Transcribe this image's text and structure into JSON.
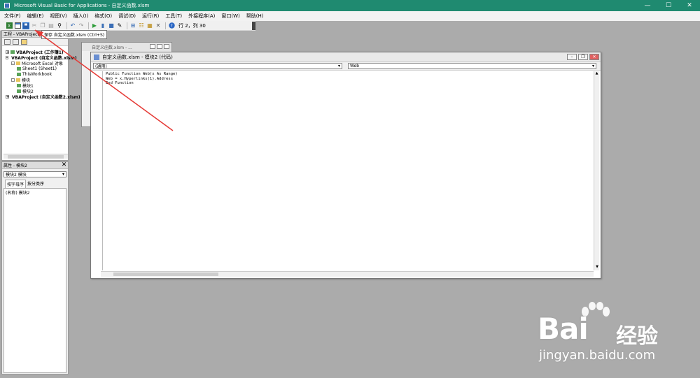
{
  "window": {
    "title": "Microsoft Visual Basic for Applications - 自定义函数.xlsm",
    "minimize": "—",
    "maximize": "☐",
    "close": "✕"
  },
  "menu": [
    "文件(F)",
    "编辑(E)",
    "视图(V)",
    "插入(I)",
    "格式(O)",
    "调试(D)",
    "运行(R)",
    "工具(T)",
    "外接程序(A)",
    "窗口(W)",
    "帮助(H)"
  ],
  "toolbar": {
    "position_text": "行 2，列 30"
  },
  "tooltip": "保存 自定义函数.xlsm (Ctrl+S)",
  "project_panel": {
    "title": "工程 - VBAProject",
    "tree": [
      {
        "indent": 0,
        "expander": "+",
        "label": "VBAProject (工作簿1)",
        "bold": true,
        "icon": "vba-project-icon"
      },
      {
        "indent": 0,
        "expander": "-",
        "label": "VBAProject (自定义函数.xlsm)",
        "bold": true,
        "icon": "vba-project-icon"
      },
      {
        "indent": 1,
        "expander": "-",
        "label": "Microsoft Excel 对象",
        "bold": false,
        "icon": "folder-icon"
      },
      {
        "indent": 2,
        "expander": "",
        "label": "Sheet1 (Sheet1)",
        "bold": false,
        "icon": "sheet-icon"
      },
      {
        "indent": 2,
        "expander": "",
        "label": "ThisWorkbook",
        "bold": false,
        "icon": "workbook-icon"
      },
      {
        "indent": 1,
        "expander": "-",
        "label": "模块",
        "bold": false,
        "icon": "folder-icon"
      },
      {
        "indent": 2,
        "expander": "",
        "label": "模块1",
        "bold": false,
        "icon": "module-icon"
      },
      {
        "indent": 2,
        "expander": "",
        "label": "模块2",
        "bold": false,
        "icon": "module-icon"
      },
      {
        "indent": 0,
        "expander": "+",
        "label": "VBAProject (自定义函数2.xlsm)",
        "bold": true,
        "icon": "vba-project-icon"
      }
    ]
  },
  "properties_panel": {
    "title": "属性 - 模块2",
    "close": "✕",
    "object_select": "模块2 模块",
    "tabs": [
      "按字母序",
      "按分类序"
    ],
    "rows": [
      {
        "name": "(名称)",
        "value": "模块2"
      }
    ]
  },
  "bg_window": {
    "title": "自定义函数.xlsm - ..."
  },
  "code_window": {
    "title": "自定义函数.xlsm - 模块2 (代码)",
    "object_dropdown": "(通用)",
    "proc_dropdown": "Web",
    "code": "Public Function Web(x As Range)\nWeb = x.Hyperlinks(1).Address\nEnd Function"
  },
  "watermark": {
    "brand": "Bai",
    "brand_suffix": "经验",
    "url": "jingyan.baidu.com"
  },
  "colors": {
    "titlebar": "#1f8a70",
    "annotation_arrow": "#e53935"
  }
}
